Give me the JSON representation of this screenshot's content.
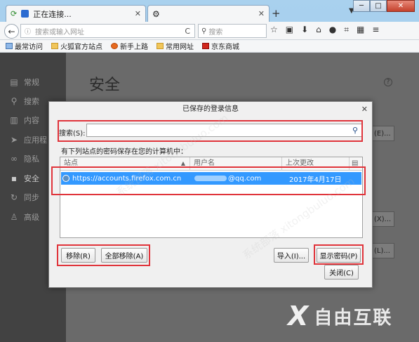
{
  "browser": {
    "tabs": [
      {
        "label": "正在连接..."
      },
      {
        "label": ""
      }
    ],
    "url_placeholder": "搜索或输入网址",
    "search_placeholder": "搜索",
    "bookmarks": [
      "最常访问",
      "火狐官方站点",
      "新手上路",
      "常用网址",
      "京东商城"
    ]
  },
  "sidebar": {
    "items": [
      {
        "label": "常规"
      },
      {
        "label": "搜索"
      },
      {
        "label": "内容"
      },
      {
        "label": "应用程"
      },
      {
        "label": "隐私"
      },
      {
        "label": "安全"
      },
      {
        "label": "同步"
      },
      {
        "label": "高级"
      }
    ]
  },
  "main": {
    "title": "安全",
    "bg_buttons": [
      "(E)...",
      "(X)...",
      "(L)..."
    ]
  },
  "dialog": {
    "title": "已保存的登录信息",
    "search_label": "搜索(S):",
    "note": "有下列站点的密码保存在您的计算机中：",
    "columns": [
      "站点",
      "用户名",
      "上次更改"
    ],
    "rows": [
      {
        "site": "https://accounts.firefox.com.cn",
        "user": "@qq.com",
        "changed": "2017年4月17日"
      }
    ],
    "buttons": {
      "remove": "移除(R)",
      "remove_all": "全部移除(A)",
      "import": "导入(I)...",
      "show_passwords": "显示密码(P)",
      "close": "关闭(C)"
    }
  },
  "watermark": "系统部落 xitongbuluo.com",
  "logo": "自由互联",
  "colors": {
    "highlight": "#e0343b",
    "selection": "#3399ff"
  }
}
